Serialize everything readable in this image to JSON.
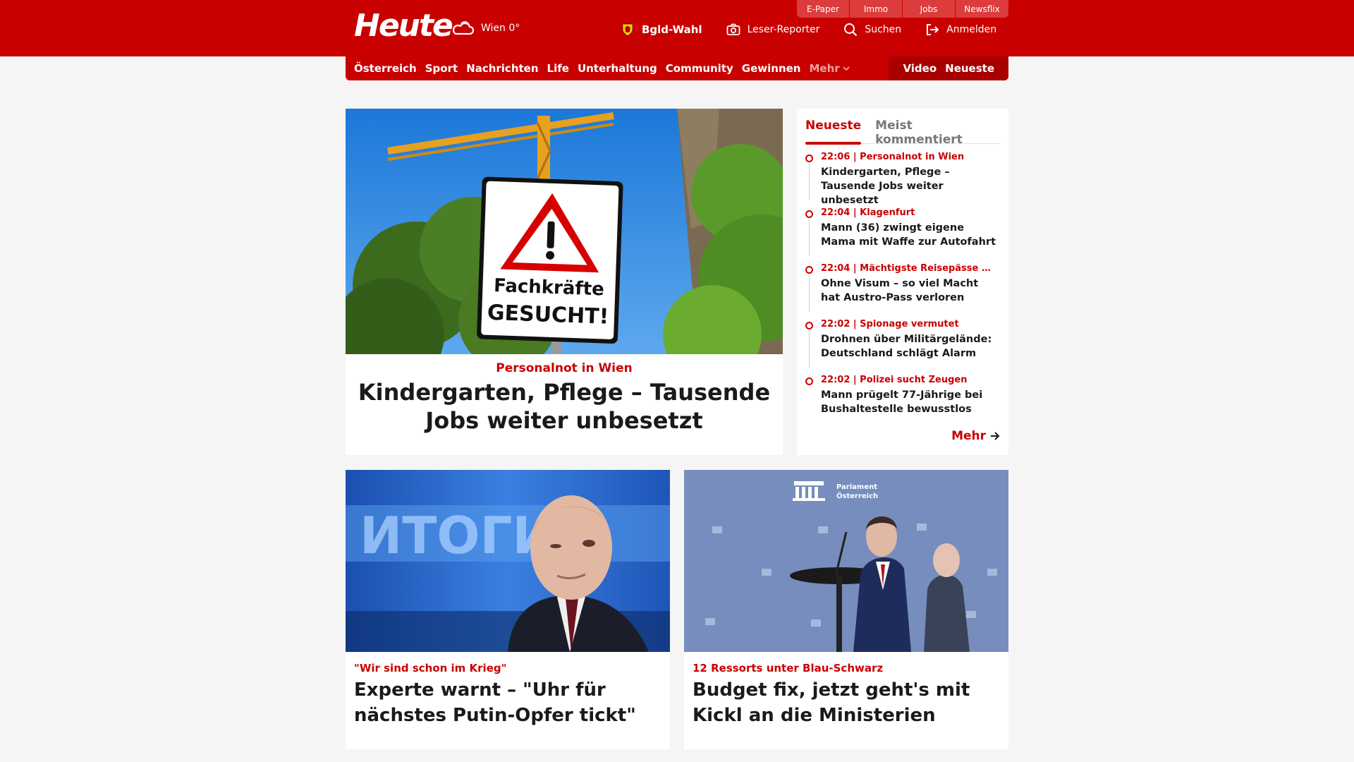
{
  "service_links": [
    "E-Paper",
    "Immo",
    "Jobs",
    "Newsflix"
  ],
  "logo": "Heute",
  "weather": {
    "label": "Wien 0°",
    "icon": "cloud-sun-icon"
  },
  "header_actions": {
    "election": "Bgld-Wahl",
    "reporter": "Leser-Reporter",
    "search": "Suchen",
    "login": "Anmelden"
  },
  "nav": {
    "items": [
      "Österreich",
      "Sport",
      "Nachrichten",
      "Life",
      "Unterhaltung",
      "Community",
      "Gewinnen"
    ],
    "more": "Mehr",
    "right": [
      "Video",
      "Neueste"
    ]
  },
  "hero": {
    "kicker": "Personalnot in Wien",
    "title": "Kindergarten, Pflege – Tausende Jobs weiter unbesetzt",
    "sign_text_1": "Fachkräfte",
    "sign_text_2": "GESUCHT!"
  },
  "sidebar": {
    "tabs": [
      "Neueste",
      "Meist kommentiert"
    ],
    "items": [
      {
        "meta": "22:06 | Personalnot in Wien",
        "title": "Kindergarten, Pflege – Tausende Jobs weiter unbesetzt"
      },
      {
        "meta": "22:04 | Klagenfurt",
        "title": "Mann (36) zwingt eigene Mama mit Waffe zur Autofahrt"
      },
      {
        "meta": "22:04 | Mächtigste Reisepässe der...",
        "title": "Ohne Visum – so viel Macht hat Austro-Pass verloren"
      },
      {
        "meta": "22:02 | Spionage vermutet",
        "title": "Drohnen über Militärgelände: Deutschland schlägt Alarm"
      },
      {
        "meta": "22:02 | Polizei sucht Zeugen",
        "title": "Mann prügelt 77-Jährige bei Bushaltestelle bewusstlos"
      }
    ],
    "more": "Mehr"
  },
  "cards": [
    {
      "kicker": "\"Wir sind schon im Krieg\"",
      "title": "Experte warnt – \"Uhr für nächstes Putin-Opfer tickt\"",
      "img_text": "ИТОГИ"
    },
    {
      "kicker": "12 Ressorts unter Blau-Schwarz",
      "title": "Budget fix, jetzt geht's mit Kickl an die Ministerien",
      "img_text_1": "Parlament",
      "img_text_2": "Österreich"
    }
  ],
  "colors": {
    "brand": "#c90000",
    "brand_dark": "#a80000"
  }
}
